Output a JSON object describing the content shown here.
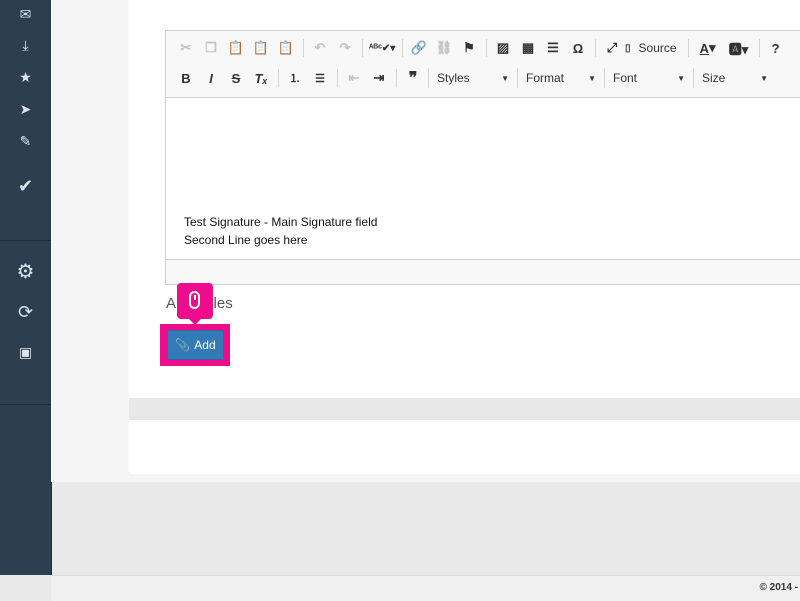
{
  "sidebar": {
    "items": [
      {
        "icon": "mail-icon",
        "glyph": "✉"
      },
      {
        "icon": "inbox-download-icon",
        "glyph": "⤓"
      },
      {
        "icon": "star-icon",
        "glyph": "★"
      },
      {
        "icon": "send-icon",
        "glyph": "➤"
      },
      {
        "icon": "compose-icon",
        "glyph": "✎"
      },
      {
        "icon": "task-check-icon",
        "glyph": "✔"
      },
      {
        "icon": "settings-gear-icon",
        "glyph": "⚙"
      },
      {
        "icon": "network-icon",
        "glyph": "⟳"
      },
      {
        "icon": "presentation-icon",
        "glyph": "▣"
      }
    ]
  },
  "editor": {
    "toolbar": {
      "source_label": "Source",
      "styles_label": "Styles",
      "format_label": "Format",
      "font_label": "Font",
      "size_label": "Size"
    },
    "content_lines": [
      "Test Signature - Main Signature field",
      "Second Line goes here"
    ]
  },
  "attach": {
    "label_start": "A",
    "label_end": "files",
    "add_button_label": "Add"
  },
  "footer": {
    "copyright": "© 2014 -"
  },
  "colors": {
    "accent": "#337ab7",
    "highlight": "#ec0c8c",
    "sidebar": "#2c3e50"
  }
}
